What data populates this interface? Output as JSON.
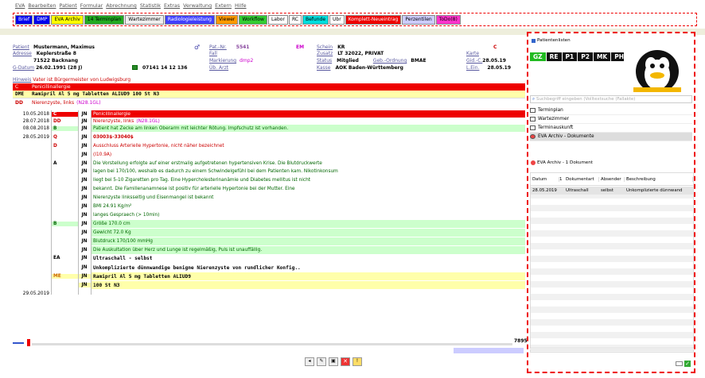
{
  "menu": [
    "EVA",
    "Bearbeiten",
    "Patient",
    "Formular",
    "Abrechnung",
    "Statistik",
    "Extras",
    "Verwaltung",
    "Extern",
    "Hilfe"
  ],
  "toolbar": [
    {
      "label": "Brief",
      "bg": "#0000ee",
      "fg": "#fff"
    },
    {
      "label": "DMP",
      "bg": "#0000ee",
      "fg": "#fff"
    },
    {
      "label": "EVA Archiv",
      "bg": "#ffff00",
      "fg": "#000"
    },
    {
      "label": "14 Terminplan",
      "bg": "#22aa22",
      "fg": "#000"
    },
    {
      "label": "Wartezimmer",
      "bg": "#eeeeee",
      "fg": "#000"
    },
    {
      "label": "Radiologieleistung",
      "bg": "#4040ff",
      "fg": "#fff"
    },
    {
      "label": "Viewer",
      "bg": "#ff9900",
      "fg": "#000"
    },
    {
      "label": "Workflow",
      "bg": "#33cc33",
      "fg": "#000"
    },
    {
      "label": "Labor",
      "bg": "#ffffff",
      "fg": "#000"
    },
    {
      "label": "RC",
      "bg": "#ffffff",
      "fg": "#000"
    },
    {
      "label": "Befunde",
      "bg": "#00dddd",
      "fg": "#000"
    },
    {
      "label": "Ubr",
      "bg": "#ffffff",
      "fg": "#000"
    },
    {
      "label": "Komplett-Neueintrag",
      "bg": "#ee0000",
      "fg": "#fff"
    },
    {
      "label": "Perzentilen",
      "bg": "#ccccff",
      "fg": "#000"
    },
    {
      "label": "ToDo(8)",
      "bg": "#ff33cc",
      "fg": "#000"
    }
  ],
  "patient": {
    "l_patient": "Patient",
    "name": "Mustermann, Maximus",
    "l_adresse": "Adresse",
    "street": "Keplerstraße 8",
    "city": "71522 Backnang",
    "l_gdatum": "G-Datum",
    "dob": "26.02.1991 (28 J)",
    "phone": "07141 14 12 136",
    "l_patnr": "Pat.-Nr.",
    "patnr": "5541",
    "em": "EM",
    "l_fall": "Fall",
    "l_markierung": "Markierung",
    "markierung": "dmp2",
    "l_ubarzt": "Üb. Arzt",
    "l_schein": "Schein",
    "schein": "KR",
    "l_zusatz": "Zusatz",
    "zusatz": "LT 32022, PRIVAT",
    "l_status": "Status",
    "status": "Mitglied",
    "l_gebordnung": "Geb.-Ordnung",
    "gebordnung": "BMAE",
    "l_kasse": "Kasse",
    "kasse": "AOK Baden-Württemberg",
    "c": "C",
    "l_karte": "Karte",
    "l_gid": "Gid.-C.",
    "gid": "28.05.19",
    "l_lein": "L.Ein.",
    "lein": "28.05.19"
  },
  "hinweis": {
    "label": "Hinweis",
    "text": "Vater ist Bürgermeister von Ludwigsburg"
  },
  "cave": {
    "code": "C",
    "text": "Penicillinallergie"
  },
  "dme": {
    "code": "DME",
    "text": "Ramipril Al 5 mg Tabletten ALIUD9 100 St N3"
  },
  "dd": {
    "code": "DD",
    "text": "Nierenzyste, links",
    "icd": "(N28.1GL)"
  },
  "journal": [
    {
      "date": "10.05.2018",
      "code": "C",
      "jn": "JN",
      "text": "Penicillinallergie",
      "style": "cave"
    },
    {
      "date": "28.07.2018",
      "code": "DD",
      "jn": "JN",
      "text": "Nierenzyste, links",
      "icd": "(N28.1GL)",
      "style": "dd"
    },
    {
      "date": "08.08.2018",
      "code": "B",
      "jn": "JN",
      "text": "Patient hat Zecke am linken Oberarm mit leichter Rötung. Impfschutz ist vorhanden.",
      "style": "befund"
    },
    {
      "date": "28.05.2019",
      "code": "Q",
      "jn": "JN",
      "text": "03003$-33040$",
      "style": "q"
    },
    {
      "date": "",
      "code": "D",
      "jn": "JN",
      "text": "Ausschluss Arterielle Hypertonie, nicht näher bezeichnet",
      "style": "diag"
    },
    {
      "date": "",
      "code": "",
      "jn": "JN",
      "text": "(I10.9A)",
      "style": "diag"
    },
    {
      "date": "",
      "code": "A",
      "jn": "JN",
      "text": "Die Vorstellung erfolgte auf einer erstmalig aufgetretenen hypertensiven Krise. Die Blutdruckwerte",
      "style": "anam"
    },
    {
      "date": "",
      "code": "",
      "jn": "JN",
      "text": "lagen bei 170/100, weshalb es dadurch zu einem Schwindelgefühl bei dem Patienten kam. Nikotinkonsum",
      "style": "anam"
    },
    {
      "date": "",
      "code": "",
      "jn": "JN",
      "text": "liegt bei 5-10 Zigaretten pro Tag. Eine Hypercholesterinanämie und Diabetes mellitus ist nicht",
      "style": "anam"
    },
    {
      "date": "",
      "code": "",
      "jn": "JN",
      "text": "bekannt. Die Familienanamnese ist positiv für arterielle Hypertonie bei der Mutter. Eine",
      "style": "anam"
    },
    {
      "date": "",
      "code": "",
      "jn": "JN",
      "text": "Nierenzyste linksseitig und Eisenmangel ist bekannt",
      "style": "anam"
    },
    {
      "date": "",
      "code": "",
      "jn": "JN",
      "text": "BMI 24.91 Kg/m²",
      "style": "anam"
    },
    {
      "date": "",
      "code": "",
      "jn": "JN",
      "text": "langes Gespraech (> 10min)",
      "style": "anam"
    },
    {
      "date": "",
      "code": "B",
      "jn": "JN",
      "text": "Größe 170.0 cm",
      "style": "befund"
    },
    {
      "date": "",
      "code": "",
      "jn": "JN",
      "text": "Gewicht 72.0 Kg",
      "style": "befund"
    },
    {
      "date": "",
      "code": "",
      "jn": "JN",
      "text": "Blutdruck 170/100 mmHg",
      "style": "befund"
    },
    {
      "date": "",
      "code": "",
      "jn": "JN",
      "text": "Die Auskultation über Herz und Lunge ist regelmäßig, Puls ist unauffällig.",
      "style": "befund"
    },
    {
      "date": "",
      "code": "EA",
      "jn": "JN",
      "text": "Ultraschall - selbst",
      "style": "ea"
    },
    {
      "date": "",
      "code": "",
      "jn": "JN",
      "text": "Unkomplizierte dünnwandige benigne Nierenzyste von rundlicher Konfig..",
      "style": "ea"
    },
    {
      "date": "",
      "code": "ME",
      "jn": "JN",
      "text": "Ramipril Al 5 mg Tabletten ALIUD9",
      "style": "me"
    },
    {
      "date": "",
      "code": "",
      "jn": "JN",
      "text": "100 St N3",
      "style": "me"
    },
    {
      "date": "29.05.2019",
      "code": "",
      "jn": "",
      "text": "",
      "style": "blank"
    }
  ],
  "right": {
    "title": "Patientenlisten",
    "badges": [
      {
        "t": "GZ",
        "bg": "#22bb22"
      },
      {
        "t": "RE",
        "bg": "#111"
      },
      {
        "t": "P1",
        "bg": "#111"
      },
      {
        "t": "P2",
        "bg": "#111"
      },
      {
        "t": "MK",
        "bg": "#111"
      },
      {
        "t": "PH",
        "bg": "#111"
      }
    ],
    "search_placeholder": "Suchbegriff eingeben (Volltextsuche (Fallakte)",
    "nav": [
      "Terminplan",
      "Wartezimmer",
      "Terminauskunft",
      "EVA Archiv - Dokumente"
    ],
    "doc_title": "EVA Archiv - 1 Dokument",
    "cols": [
      "Datum",
      "Dokumentart",
      "Absender",
      "Beschreibung"
    ],
    "sort_num": "1",
    "row": [
      "28.05.2019",
      "Ultraschall",
      "selbst",
      "Unkomplizierte dünnwand"
    ]
  },
  "status": {
    "count": "7895"
  }
}
